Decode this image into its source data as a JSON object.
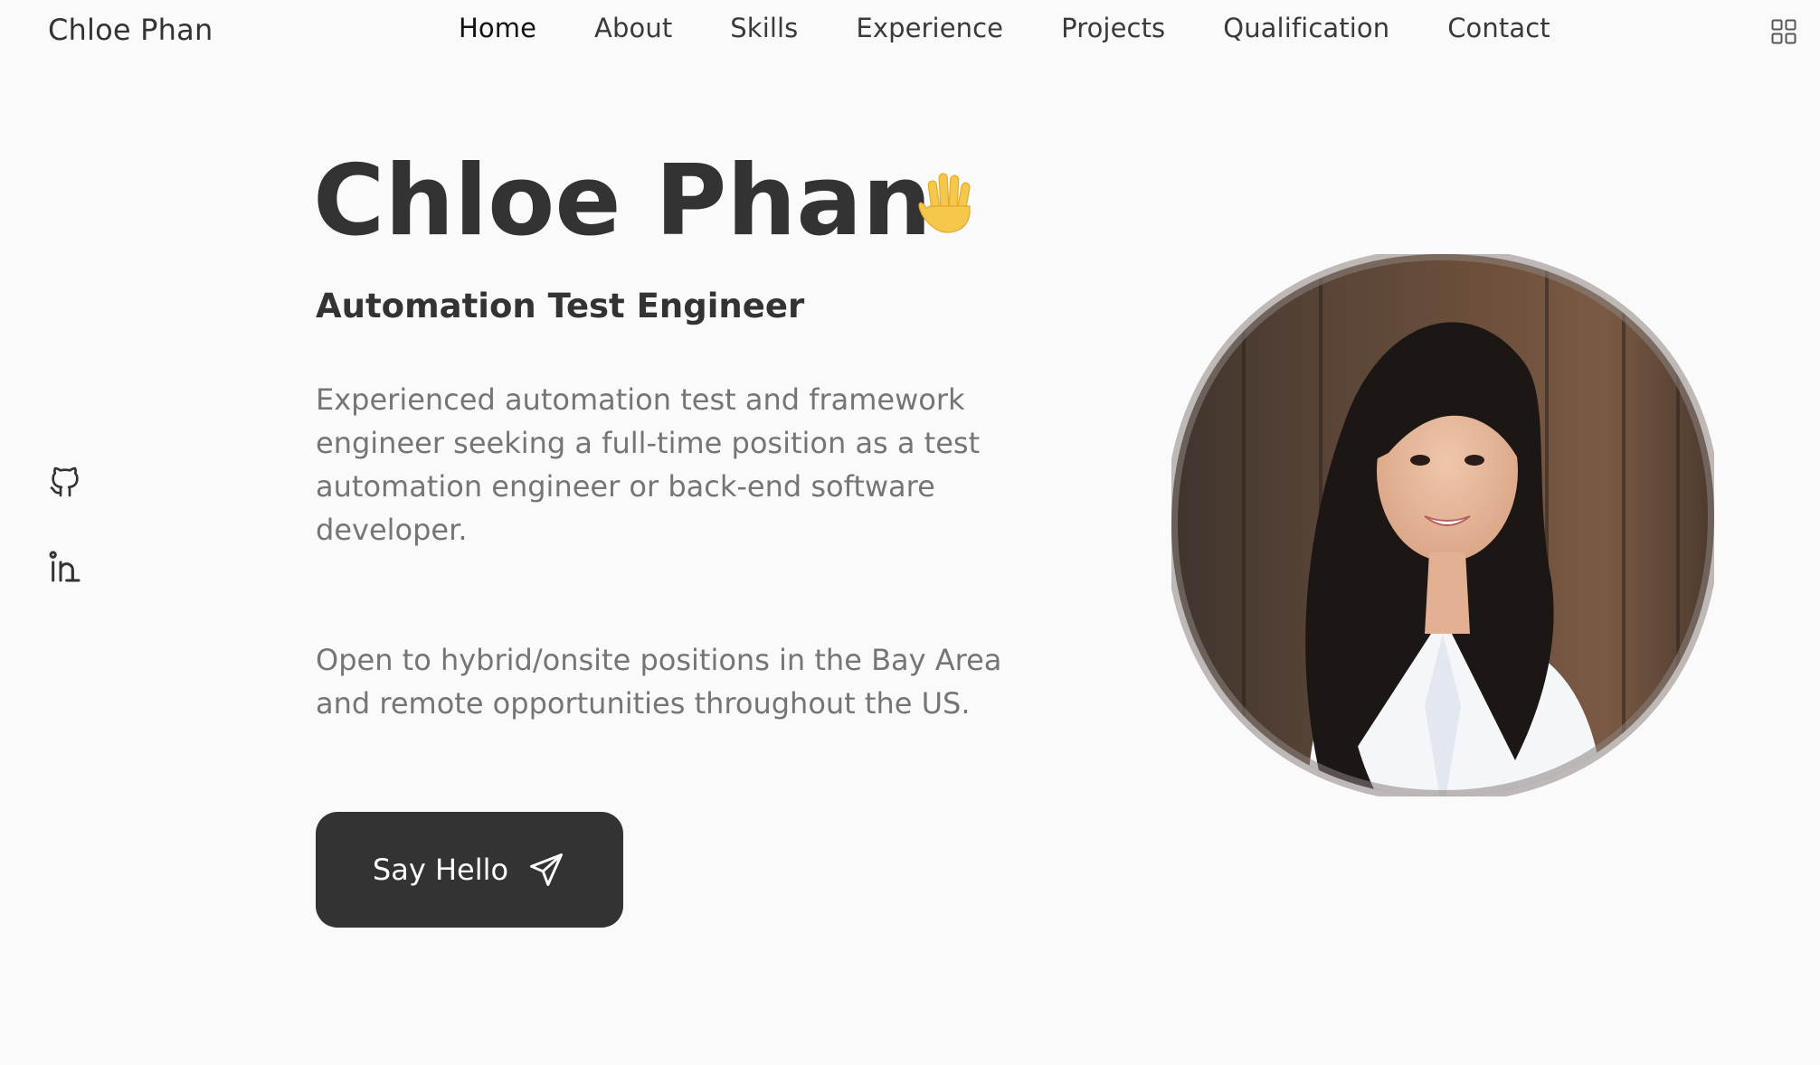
{
  "header": {
    "logo": "Chloe Phan",
    "nav": [
      {
        "label": "Home",
        "active": true
      },
      {
        "label": "About"
      },
      {
        "label": "Skills"
      },
      {
        "label": "Experience"
      },
      {
        "label": "Projects"
      },
      {
        "label": "Qualification"
      },
      {
        "label": "Contact"
      }
    ],
    "menu_icon": "grid-icon"
  },
  "social": {
    "icons": [
      "github-icon",
      "linkedin-icon"
    ]
  },
  "hero": {
    "name": "Chloe Phan",
    "wave_icon": "waving-hand-icon",
    "title": "Automation Test Engineer",
    "description": "Experienced automation test and framework engineer seeking a full-time position as a test automation engineer or back-end software developer.",
    "note": "Open to hybrid/onsite positions in the Bay Area and remote opportunities throughout the US.",
    "button_label": "Say Hello",
    "button_icon": "send-icon"
  },
  "colors": {
    "background": "#fafafa",
    "text_dark": "#333333",
    "text_muted": "#757575",
    "button_bg": "#333333",
    "wave": "#f5c84b"
  }
}
